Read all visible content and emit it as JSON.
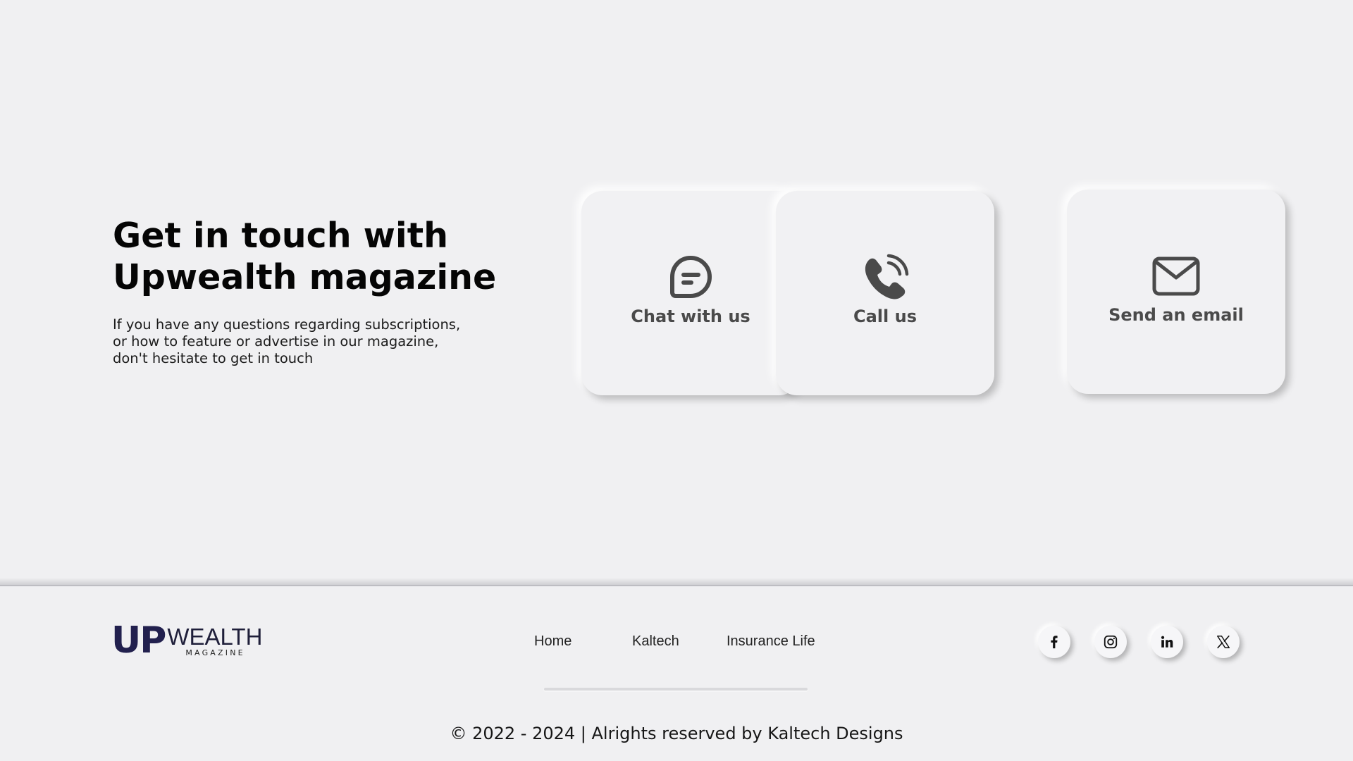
{
  "hero": {
    "title_line1": "Get in touch with",
    "title_line2": "Upwealth magazine",
    "description_line1": "If you have any questions regarding subscriptions,",
    "description_line2": "or how to feature or advertise in our magazine,",
    "description_line3": "don't hesitate to get in touch"
  },
  "contact_cards": {
    "chat": {
      "label": "Chat with us",
      "icon": "chat-bubble-icon"
    },
    "call": {
      "label": "Call us",
      "icon": "phone-icon"
    },
    "email": {
      "label": "Send an email",
      "icon": "envelope-icon"
    }
  },
  "footer": {
    "logo": {
      "primary": "UP",
      "secondary": "WEALTH",
      "tagline": "MAGAZINE"
    },
    "nav": {
      "home": "Home",
      "kaltech": "Kaltech",
      "insurance": "Insurance Life"
    },
    "social": {
      "facebook": "facebook-icon",
      "instagram": "instagram-icon",
      "linkedin": "linkedin-icon",
      "x": "x-icon"
    },
    "copyright": "© 2022 - 2024 | Alrights reserved by Kaltech Designs"
  },
  "colors": {
    "background": "#f0f0f2",
    "card_icon": "#4a4a4a",
    "logo_primary": "#22204e",
    "text_dark": "#050505"
  }
}
